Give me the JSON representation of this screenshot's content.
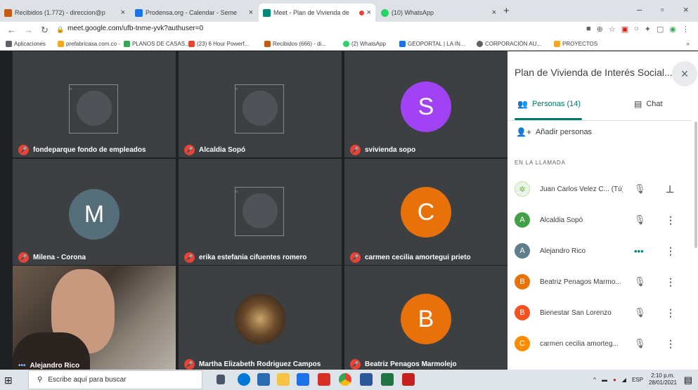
{
  "browser": {
    "tabs": [
      {
        "title": "Recibidos (1.772) - direccion@p",
        "color": "#c55a11",
        "active": false
      },
      {
        "title": "Prodensa.org - Calendar - Seme",
        "color": "#1a73e8",
        "active": false
      },
      {
        "title": "Meet - Plan de Vivienda de",
        "color": "#00897b",
        "active": true
      },
      {
        "title": "(10) WhatsApp",
        "color": "#25d366",
        "active": false
      }
    ],
    "url": "meet.google.com/ufb-tnme-yvk?authuser=0",
    "bookmarks": [
      {
        "label": "Aplicaciones",
        "color": "#5f6368"
      },
      {
        "label": "prefabricasa.com.co -",
        "color": "#f9a825"
      },
      {
        "label": "PLANOS DE CASAS...",
        "color": "#34a853"
      },
      {
        "label": "(23) 6 Hour Powerf...",
        "color": "#ea4335"
      },
      {
        "label": "Recibidos (666) - di...",
        "color": "#c55a11"
      },
      {
        "label": "(2) WhatsApp",
        "color": "#25d366"
      },
      {
        "label": "GEOPORTAL | LA IN...",
        "color": "#1a73e8"
      },
      {
        "label": "CORPORACIÓN AU...",
        "color": "#5f6368"
      },
      {
        "label": "PROYECTOS",
        "color": "#f9a825"
      }
    ]
  },
  "tiles": [
    {
      "name": "fondeparque fondo de empleados",
      "kind": "image"
    },
    {
      "name": "Alcaldia Sopó",
      "kind": "image"
    },
    {
      "name": "svivienda sopo",
      "kind": "avatar",
      "initial": "S",
      "color": "#a142f4"
    },
    {
      "name": "Milena - Corona",
      "kind": "avatar",
      "initial": "M",
      "color": "#546e7a"
    },
    {
      "name": "erika estefania cifuentes romero",
      "kind": "image"
    },
    {
      "name": "carmen cecilia amortegui prieto",
      "kind": "avatar",
      "initial": "C",
      "color": "#e8710a"
    },
    {
      "name": "Alejandro Rico",
      "kind": "video"
    },
    {
      "name": "Martha Elizabeth Rodriguez Campos",
      "kind": "photo"
    },
    {
      "name": "Beatriz Penagos Marmolejo",
      "kind": "avatar",
      "initial": "B",
      "color": "#e8710a"
    }
  ],
  "panel": {
    "title": "Plan de Vivienda de Interés Social...",
    "tab_people": "Personas (14)",
    "tab_chat": "Chat",
    "add_people": "Añadir personas",
    "section": "EN LA LLAMADA",
    "people": [
      {
        "name": "Juan Carlos Velez C... (Tú)",
        "initial": "",
        "color": "#7cb342",
        "status": "muted",
        "action": "pin"
      },
      {
        "name": "Alcaldia Sopó",
        "initial": "A",
        "color": "#43a047",
        "status": "muted",
        "action": "more"
      },
      {
        "name": "Alejandro Rico",
        "initial": "A",
        "color": "#607d8b",
        "status": "speaking",
        "action": "more"
      },
      {
        "name": "Beatriz Penagos Marmo...",
        "initial": "B",
        "color": "#e8710a",
        "status": "muted",
        "action": "more"
      },
      {
        "name": "Bienestar San Lorenzo",
        "initial": "B",
        "color": "#f4511e",
        "status": "muted",
        "action": "more"
      },
      {
        "name": "carmen cecilia amorteg...",
        "initial": "C",
        "color": "#fb8c00",
        "status": "muted",
        "action": "more"
      }
    ]
  },
  "taskbar": {
    "search_placeholder": "Escribe aquí para buscar",
    "lang": "ESP",
    "time": "2:10 p.m.",
    "date": "28/01/2021"
  }
}
